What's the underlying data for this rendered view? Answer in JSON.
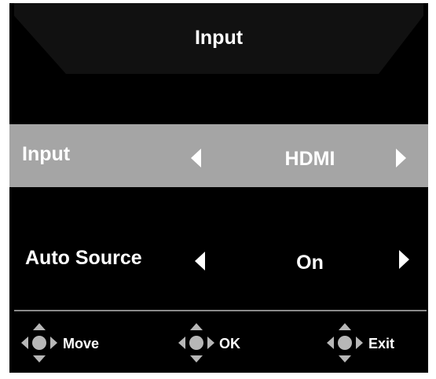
{
  "header": {
    "title": "Input"
  },
  "rows": [
    {
      "label": "Input",
      "value": "HDMI",
      "selected": true
    },
    {
      "label": "Auto Source",
      "value": "On",
      "selected": false
    }
  ],
  "footer": [
    {
      "icon": "joystick-icon",
      "label": "Move"
    },
    {
      "icon": "joystick-icon",
      "label": "OK"
    },
    {
      "icon": "joystick-icon",
      "label": "Exit"
    }
  ],
  "colors": {
    "background": "#000000",
    "header_panel": "#111111",
    "selected_row": "#a5a5a5",
    "divider": "#8a8a8a",
    "text": "#ffffff",
    "icon": "#b7b7b7"
  }
}
